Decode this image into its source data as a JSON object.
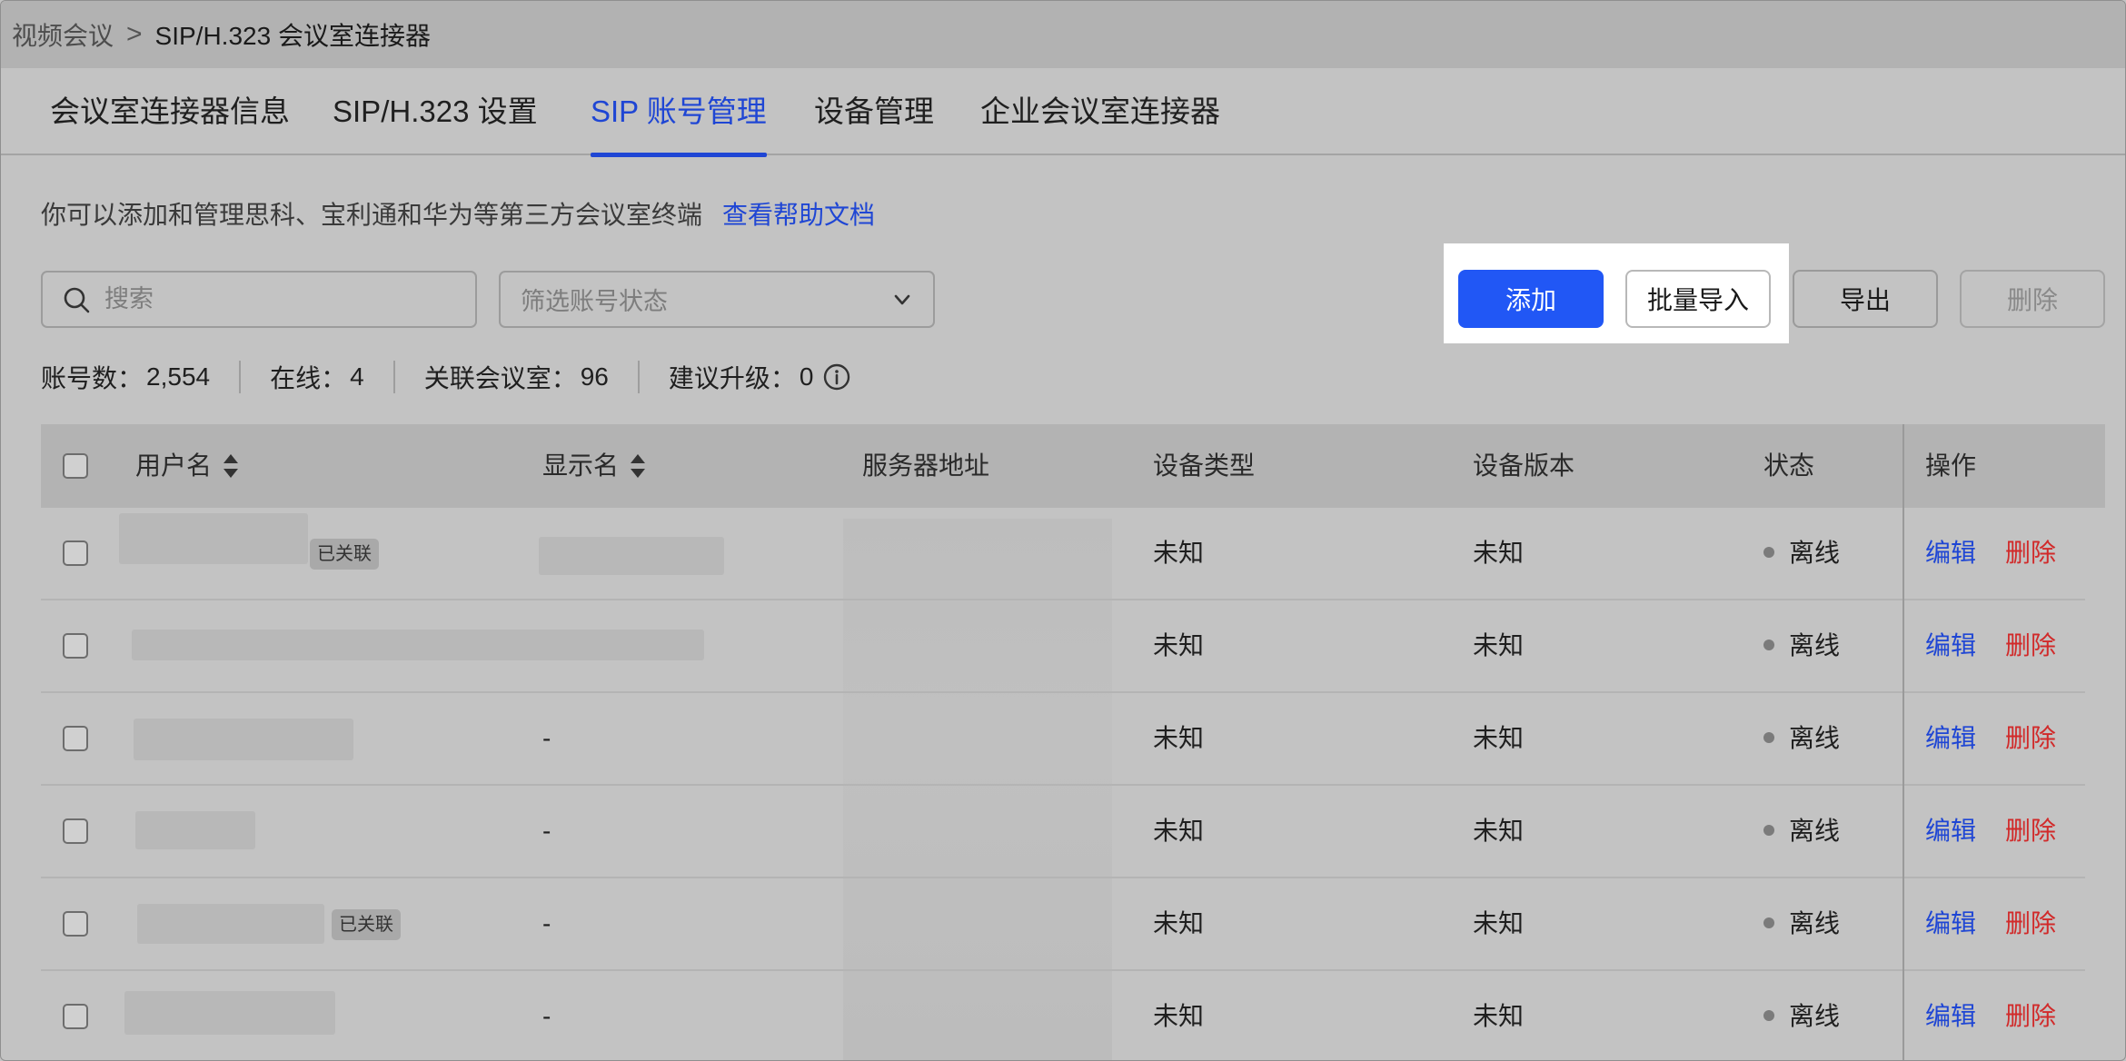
{
  "breadcrumb": {
    "root": "视频会议",
    "separator": ">",
    "current": "SIP/H.323 会议室连接器"
  },
  "tabs": [
    {
      "label": "会议室连接器信息",
      "active": false
    },
    {
      "label": "SIP/H.323 设置",
      "active": false
    },
    {
      "label": "SIP 账号管理",
      "active": true
    },
    {
      "label": "设备管理",
      "active": false
    },
    {
      "label": "企业会议室连接器",
      "active": false
    }
  ],
  "description": {
    "text": "你可以添加和管理思科、宝利通和华为等第三方会议室终端",
    "help_link": "查看帮助文档"
  },
  "search": {
    "placeholder": "搜索",
    "value": ""
  },
  "filter": {
    "placeholder": "筛选账号状态"
  },
  "buttons": {
    "add": "添加",
    "batch_import": "批量导入",
    "export": "导出",
    "delete": "删除"
  },
  "stats": {
    "accounts_label": "账号数：",
    "accounts_value": "2,554",
    "online_label": "在线：",
    "online_value": "4",
    "linked_rooms_label": "关联会议室：",
    "linked_rooms_value": "96",
    "upgrade_label": "建议升级：",
    "upgrade_value": "0"
  },
  "table": {
    "headers": {
      "username": "用户名",
      "display_name": "显示名",
      "server": "服务器地址",
      "device_type": "设备类型",
      "device_version": "设备版本",
      "status": "状态",
      "actions": "操作"
    },
    "linked_tag": "已关联",
    "edit_label": "编辑",
    "delete_label": "删除",
    "rows": [
      {
        "display_name": "",
        "device_type": "未知",
        "device_version": "未知",
        "status": "离线"
      },
      {
        "display_name": "",
        "device_type": "未知",
        "device_version": "未知",
        "status": "离线"
      },
      {
        "display_name": "-",
        "device_type": "未知",
        "device_version": "未知",
        "status": "离线"
      },
      {
        "display_name": "-",
        "device_type": "未知",
        "device_version": "未知",
        "status": "离线"
      },
      {
        "display_name": "-",
        "device_type": "未知",
        "device_version": "未知",
        "status": "离线"
      },
      {
        "display_name": "-",
        "device_type": "未知",
        "device_version": "未知",
        "status": "离线"
      }
    ]
  },
  "colors": {
    "accent": "#1f46d4",
    "primary_button": "#2157f5",
    "danger": "#d12a2a"
  }
}
